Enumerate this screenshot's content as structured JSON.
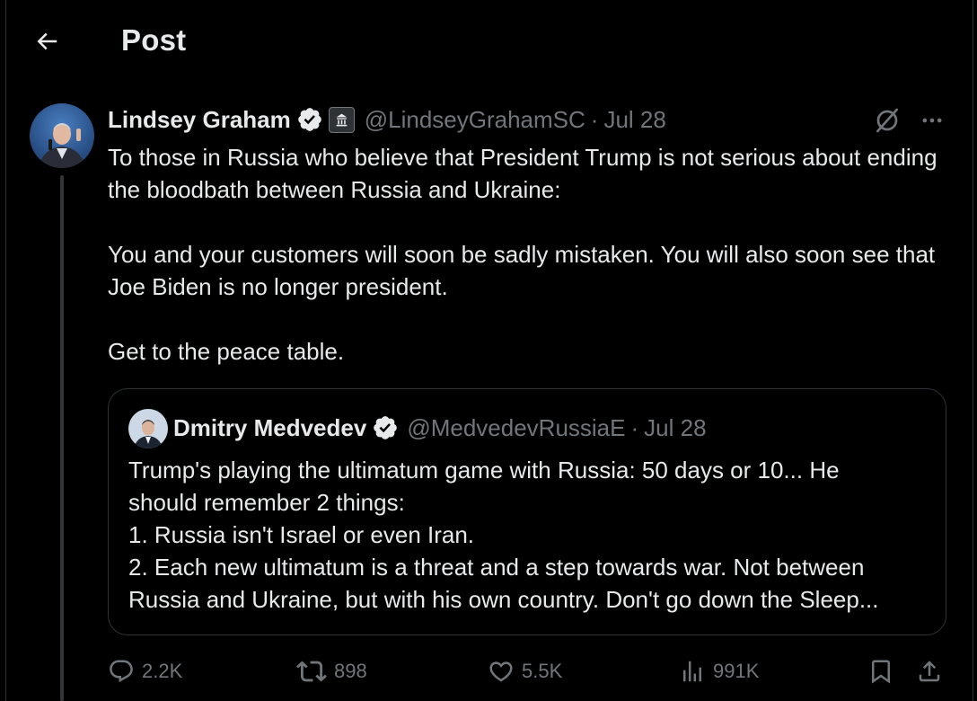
{
  "header": {
    "title": "Post"
  },
  "post": {
    "author_name": "Lindsey Graham",
    "handle": "@LindseyGrahamSC",
    "separator": "·",
    "date": "Jul 28",
    "paragraphs": [
      "To those in Russia who believe that President Trump is not serious about ending the bloodbath between Russia and Ukraine:",
      "You and your customers will soon be sadly mistaken. You will also soon see that Joe Biden is no longer president.",
      "Get to the peace table."
    ]
  },
  "quote": {
    "author_name": "Dmitry Medvedev",
    "handle": "@MedvedevRussiaE",
    "separator": "·",
    "date": "Jul 28",
    "lines": [
      "Trump's playing the ultimatum game with Russia: 50 days or 10... He",
      "should remember 2 things:",
      "1. Russia isn't Israel or even Iran.",
      "2. Each new ultimatum is a threat and a step towards war. Not between",
      "Russia and Ukraine, but with his own country. Don't go down the Sleep..."
    ]
  },
  "actions": {
    "replies": "2.2K",
    "reposts": "898",
    "likes": "5.5K",
    "views": "991K"
  },
  "icons": {
    "back": "arrow-left-icon",
    "verified": "verified-badge-icon",
    "government": "government-building-icon",
    "grok": "grok-icon",
    "more": "more-dots-icon",
    "reply": "reply-icon",
    "repost": "repost-icon",
    "like": "heart-icon",
    "views": "views-chart-icon",
    "bookmark": "bookmark-icon",
    "share": "share-icon"
  },
  "colors": {
    "background": "#000000",
    "text_primary": "#e7e9ea",
    "text_secondary": "#71767b",
    "border": "#2f3336",
    "verified_badge": "#e7e9ea"
  }
}
